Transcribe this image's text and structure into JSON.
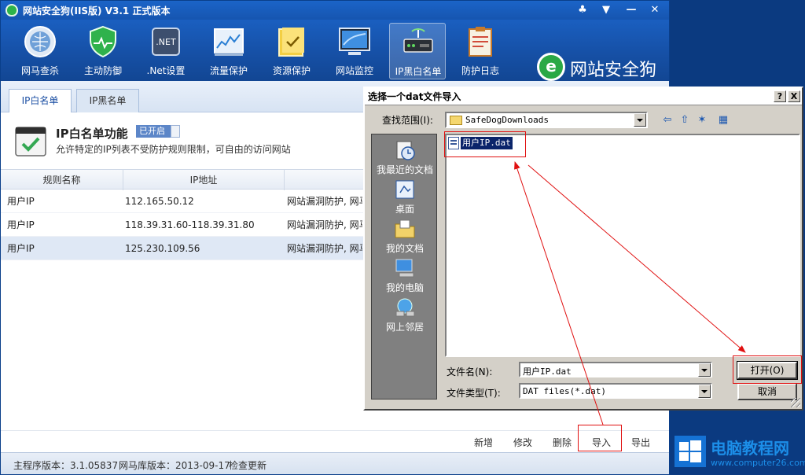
{
  "app": {
    "title": "网站安全狗(IIS版) V3.1 正式版本",
    "controls": {
      "skin": "♣",
      "menu": "▼",
      "minimize": "—",
      "close": "✕"
    }
  },
  "toolbar": {
    "items": [
      {
        "label": "网马查杀",
        "icon": "globe-scan-icon"
      },
      {
        "label": "主动防御",
        "icon": "shield-check-icon"
      },
      {
        "label": ".Net设置",
        "icon": "dotnet-icon"
      },
      {
        "label": "流量保护",
        "icon": "traffic-chart-icon"
      },
      {
        "label": "资源保护",
        "icon": "folder-check-icon"
      },
      {
        "label": "网站监控",
        "icon": "monitor-icon"
      },
      {
        "label": "IP黑白名单",
        "icon": "router-icon",
        "active": true
      },
      {
        "label": "防护日志",
        "icon": "clipboard-icon"
      }
    ],
    "brand": "网站安全狗",
    "brand_mark": "e"
  },
  "tabs": [
    {
      "label": "IP白名单",
      "active": true
    },
    {
      "label": "IP黑名单",
      "active": false
    }
  ],
  "feature": {
    "title": "IP白名单功能",
    "badge": "已开启",
    "description": "允许特定的IP列表不受防护规则限制，可自由的访问网站"
  },
  "table": {
    "columns": [
      "规则名称",
      "IP地址",
      ""
    ],
    "rows": [
      {
        "name": "用户IP",
        "ip": "112.165.50.12",
        "note": "网站漏洞防护, 网马"
      },
      {
        "name": "用户IP",
        "ip": "118.39.31.60-118.39.31.80",
        "note": "网站漏洞防护, 网马"
      },
      {
        "name": "用户IP",
        "ip": "125.230.109.56",
        "note": "网站漏洞防护, 网马",
        "selected": true
      }
    ]
  },
  "actions": {
    "add": "新增",
    "edit": "修改",
    "delete": "删除",
    "import": "导入",
    "export": "导出"
  },
  "status": {
    "main_version": "主程序版本：3.1.05837",
    "db_version": "网马库版本：2013-09-17",
    "check_update": "检查更新"
  },
  "dialog": {
    "title": "选择一个dat文件导入",
    "help": "?",
    "close": "X",
    "look_in_label": "查找范围(I):",
    "look_in_value": "SafeDogDownloads",
    "nav": {
      "back": "⇦",
      "up": "⇧",
      "new_folder": "✶",
      "views": "▦"
    },
    "places": [
      {
        "label": "我最近的文档",
        "icon": "recent-docs-icon"
      },
      {
        "label": "桌面",
        "icon": "desktop-icon"
      },
      {
        "label": "我的文档",
        "icon": "my-documents-icon"
      },
      {
        "label": "我的电脑",
        "icon": "my-computer-icon"
      },
      {
        "label": "网上邻居",
        "icon": "network-icon"
      }
    ],
    "files": [
      {
        "name": "用户IP.dat"
      }
    ],
    "filename_label": "文件名(N):",
    "filename_value": "用户IP.dat",
    "filetype_label": "文件类型(T):",
    "filetype_value": "DAT files(*.dat)",
    "open_button": "打开(O)",
    "cancel_button": "取消"
  },
  "watermark": {
    "main": "电脑教程网",
    "sub": "www.computer26.com"
  },
  "colors": {
    "accent": "#1655b0",
    "annotation": "#e01010",
    "selection": "#0a246a",
    "brand_green": "#2aa845"
  }
}
